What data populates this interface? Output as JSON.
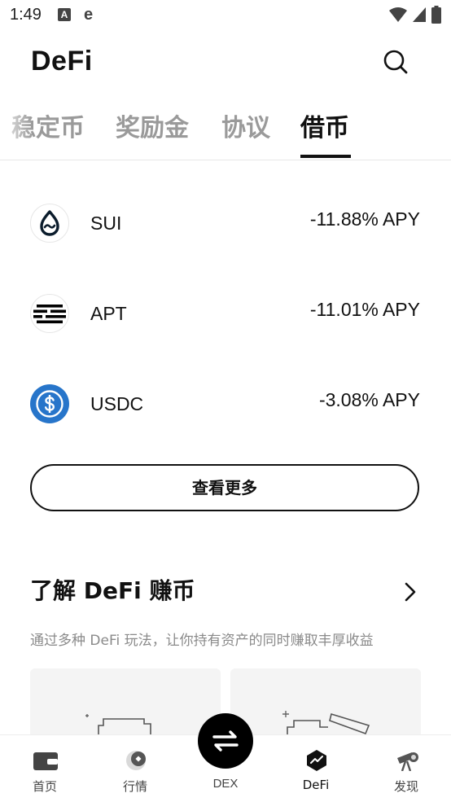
{
  "status_bar": {
    "time": "1:49",
    "icon_a": "A",
    "icon_e": "e"
  },
  "header": {
    "title": "DeFi",
    "search_icon": "search-icon"
  },
  "tabs": [
    {
      "label": "稳定币",
      "active": false
    },
    {
      "label": "奖励金",
      "active": false
    },
    {
      "label": "协议",
      "active": false
    },
    {
      "label": "借币",
      "active": true
    }
  ],
  "assets": [
    {
      "symbol": "SUI",
      "apy": "-11.88% APY",
      "icon": "sui-logo-icon"
    },
    {
      "symbol": "APT",
      "apy": "-11.01% APY",
      "icon": "apt-logo-icon"
    },
    {
      "symbol": "USDC",
      "apy": "-3.08% APY",
      "icon": "usdc-logo-icon"
    }
  ],
  "more_button": "查看更多",
  "learn": {
    "title": "了解 DeFi 赚币",
    "subtitle": "通过多种 DeFi 玩法，让你持有资产的同时赚取丰厚收益"
  },
  "bottom_nav": [
    {
      "label": "首页",
      "icon": "wallet-icon",
      "active": false
    },
    {
      "label": "行情",
      "icon": "market-icon",
      "active": false
    },
    {
      "label": "DEX",
      "icon": "swap-arrows-icon",
      "active": false
    },
    {
      "label": "DeFi",
      "icon": "defi-chart-icon",
      "active": true
    },
    {
      "label": "发现",
      "icon": "telescope-icon",
      "active": false
    }
  ],
  "colors": {
    "text": "#111111",
    "muted": "#9a9a9a",
    "usdc_blue": "#2775CA",
    "card_bg": "#f4f4f4"
  }
}
